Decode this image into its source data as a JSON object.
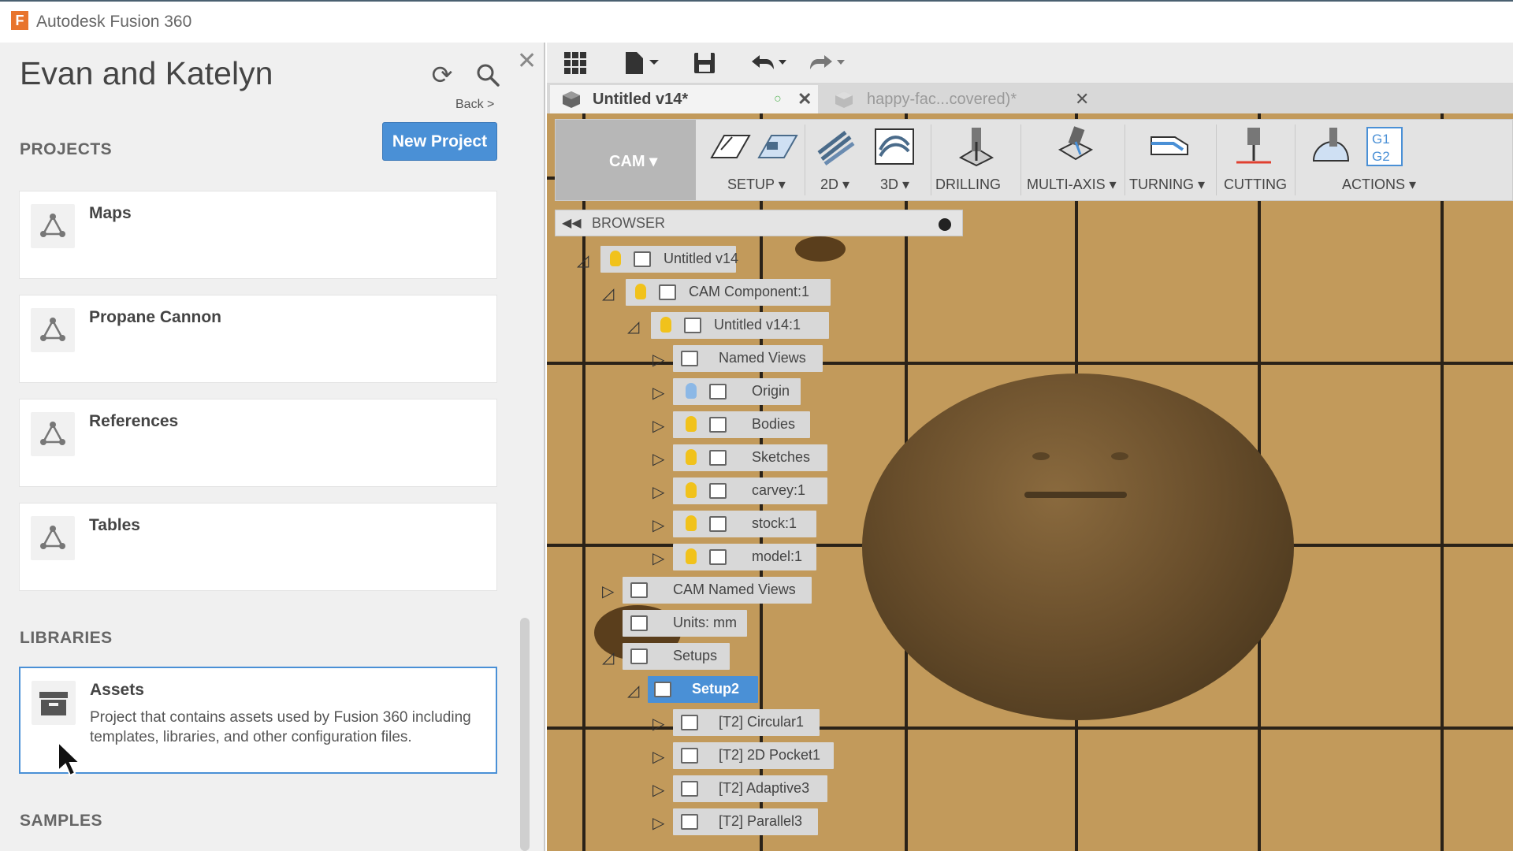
{
  "titlebar": {
    "app_title": "Autodesk Fusion 360",
    "logo_letter": "F"
  },
  "data_panel": {
    "hub_name": "Evan and Katelyn",
    "back_label": "Back >",
    "projects_heading": "PROJECTS",
    "new_project_label": "New Project",
    "projects": [
      {
        "name": "Maps"
      },
      {
        "name": "Propane Cannon"
      },
      {
        "name": "References"
      },
      {
        "name": "Tables"
      }
    ],
    "libraries_heading": "LIBRARIES",
    "library": {
      "name": "Assets",
      "description": "Project that contains assets used by Fusion 360 including templates, libraries, and other configuration files."
    },
    "samples_heading": "SAMPLES"
  },
  "tabs": [
    {
      "label": "Untitled v14*",
      "active": true
    },
    {
      "label": "happy-fac...covered)*",
      "active": false
    }
  ],
  "toolbar": {
    "workspace": "CAM ▾",
    "groups": [
      {
        "label": "SETUP ▾"
      },
      {
        "label": "2D ▾"
      },
      {
        "label": "3D ▾"
      },
      {
        "label": "DRILLING"
      },
      {
        "label": "MULTI-AXIS ▾"
      },
      {
        "label": "TURNING ▾"
      },
      {
        "label": "CUTTING"
      },
      {
        "label": "ACTIONS ▾"
      }
    ]
  },
  "browser": {
    "title": "BROWSER",
    "nodes": [
      {
        "label": "Untitled v14"
      },
      {
        "label": "CAM Component:1"
      },
      {
        "label": "Untitled v14:1"
      },
      {
        "label": "Named Views"
      },
      {
        "label": "Origin"
      },
      {
        "label": "Bodies"
      },
      {
        "label": "Sketches"
      },
      {
        "label": "carvey:1"
      },
      {
        "label": "stock:1"
      },
      {
        "label": "model:1"
      },
      {
        "label": "CAM Named Views"
      },
      {
        "label": "Units: mm"
      },
      {
        "label": "Setups"
      },
      {
        "label": "Setup2"
      },
      {
        "label": "[T2] Circular1"
      },
      {
        "label": "[T2] 2D Pocket1"
      },
      {
        "label": "[T2] Adaptive3"
      },
      {
        "label": "[T2] Parallel3"
      }
    ]
  },
  "colors": {
    "accent": "#4a90d6",
    "logo": "#e8742c",
    "wood": "#c29a5b"
  }
}
